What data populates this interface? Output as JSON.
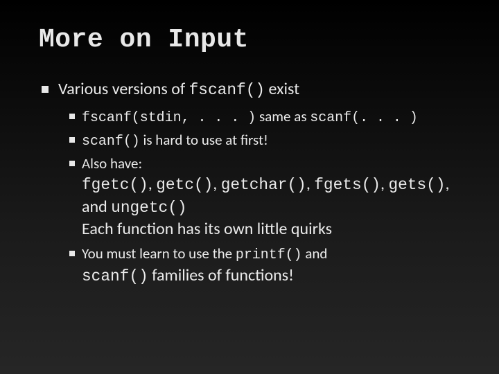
{
  "title": "More on Input",
  "b1": {
    "t1": "Various versions of ",
    "c1": "fscanf()",
    "t2": " exist"
  },
  "b1s1": {
    "c1": "fscanf(stdin, . . . )",
    "t1": " same as ",
    "c2": "scanf(. . . )"
  },
  "b1s2": {
    "c1": "scanf()",
    "t1": " is hard to use at first!"
  },
  "b1s3": {
    "t1": "Also have:"
  },
  "b1s3a": {
    "c1": "fgetc()",
    "sep1": ", ",
    "c2": "getc()",
    "sep2": ", ",
    "c3": "getchar()",
    "sep3": ", ",
    "c4": "fgets()",
    "sep4": ", ",
    "c5": "gets()",
    "sep5": ",",
    "t2a": "and ",
    "c6": "ungetc()",
    "t3": "Each function has its own little quirks"
  },
  "b1s4": {
    "t1": "You must learn to use the ",
    "c1": "printf()",
    "t2": " and ",
    "c2": "scanf()",
    "t3": "  families of functions!"
  }
}
